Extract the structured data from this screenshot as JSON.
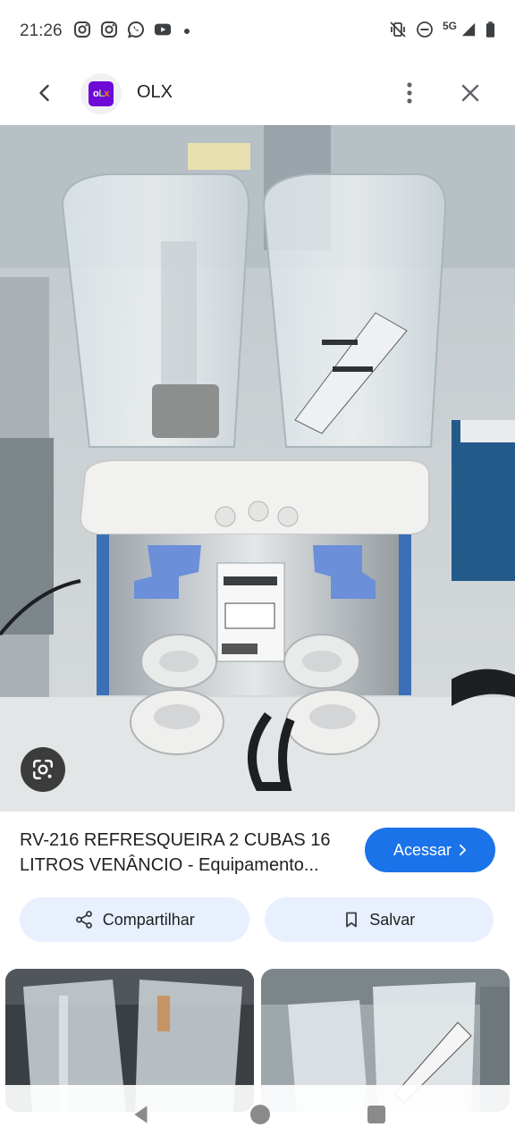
{
  "status_bar": {
    "time": "21:26",
    "network": "5G",
    "left_icons": [
      "instagram-icon",
      "instagram-icon",
      "whatsapp-icon",
      "youtube-icon"
    ],
    "right_icons": [
      "vibrate-off-icon",
      "do-not-disturb-icon",
      "signal-icon",
      "battery-icon"
    ]
  },
  "top_bar": {
    "site_name": "OLX",
    "logo_text": {
      "o": "o",
      "l": "L",
      "x": "x"
    }
  },
  "result": {
    "title": "RV-216 REFRESQUEIRA 2 CUBAS 16 LITROS VENÂNCIO - Equipamento...",
    "visit_label": "Acessar"
  },
  "actions": {
    "share_label": "Compartilhar",
    "save_label": "Salvar"
  },
  "colors": {
    "accent": "#1a73e8",
    "chip_bg": "#e8f0fe",
    "olx_purple": "#6e0ad6",
    "olx_green": "#8ce563",
    "olx_orange": "#f28000"
  }
}
